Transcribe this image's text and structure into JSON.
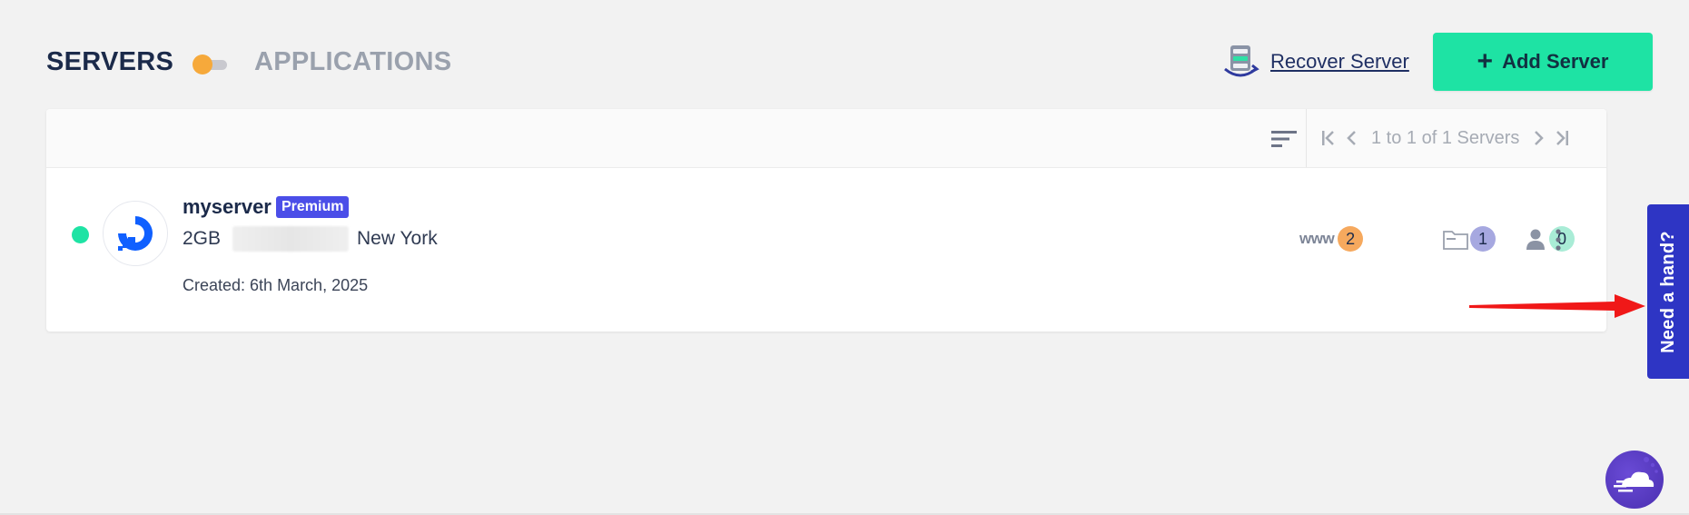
{
  "header": {
    "servers_title": "SERVERS",
    "applications_title": "APPLICATIONS",
    "recover_label": "Recover Server",
    "add_server_label": "Add Server",
    "add_server_plus": "+"
  },
  "toolbar": {
    "pagination_text": "1 to 1 of 1 Servers"
  },
  "server": {
    "name": "myserver",
    "badge": "Premium",
    "size": "2GB",
    "location": "New York",
    "created": "Created: 6th March, 2025",
    "status": "running",
    "www_label": "www",
    "www_count": "2",
    "apps_count": "1",
    "users_count": "0"
  },
  "help": {
    "tab_label": "Need a hand?"
  },
  "colors": {
    "accent_green": "#1ee3a4",
    "premium_badge": "#4b4ee8",
    "toggle_knob": "#f6a93b",
    "www_badge": "#f6a95e",
    "apps_badge": "#a6a8e0",
    "users_badge": "#a9ecd6",
    "help_tab": "#2e35c4"
  },
  "icons": {
    "recover": "server-recover-icon",
    "sort": "sort-lines-icon",
    "first": "first-page-icon",
    "prev": "prev-page-icon",
    "next": "next-page-icon",
    "last": "last-page-icon",
    "provider": "digitalocean-logo",
    "apps": "folder-icon",
    "users": "user-icon",
    "menu": "kebab-menu-icon",
    "chat": "chat-cloud-icon"
  }
}
